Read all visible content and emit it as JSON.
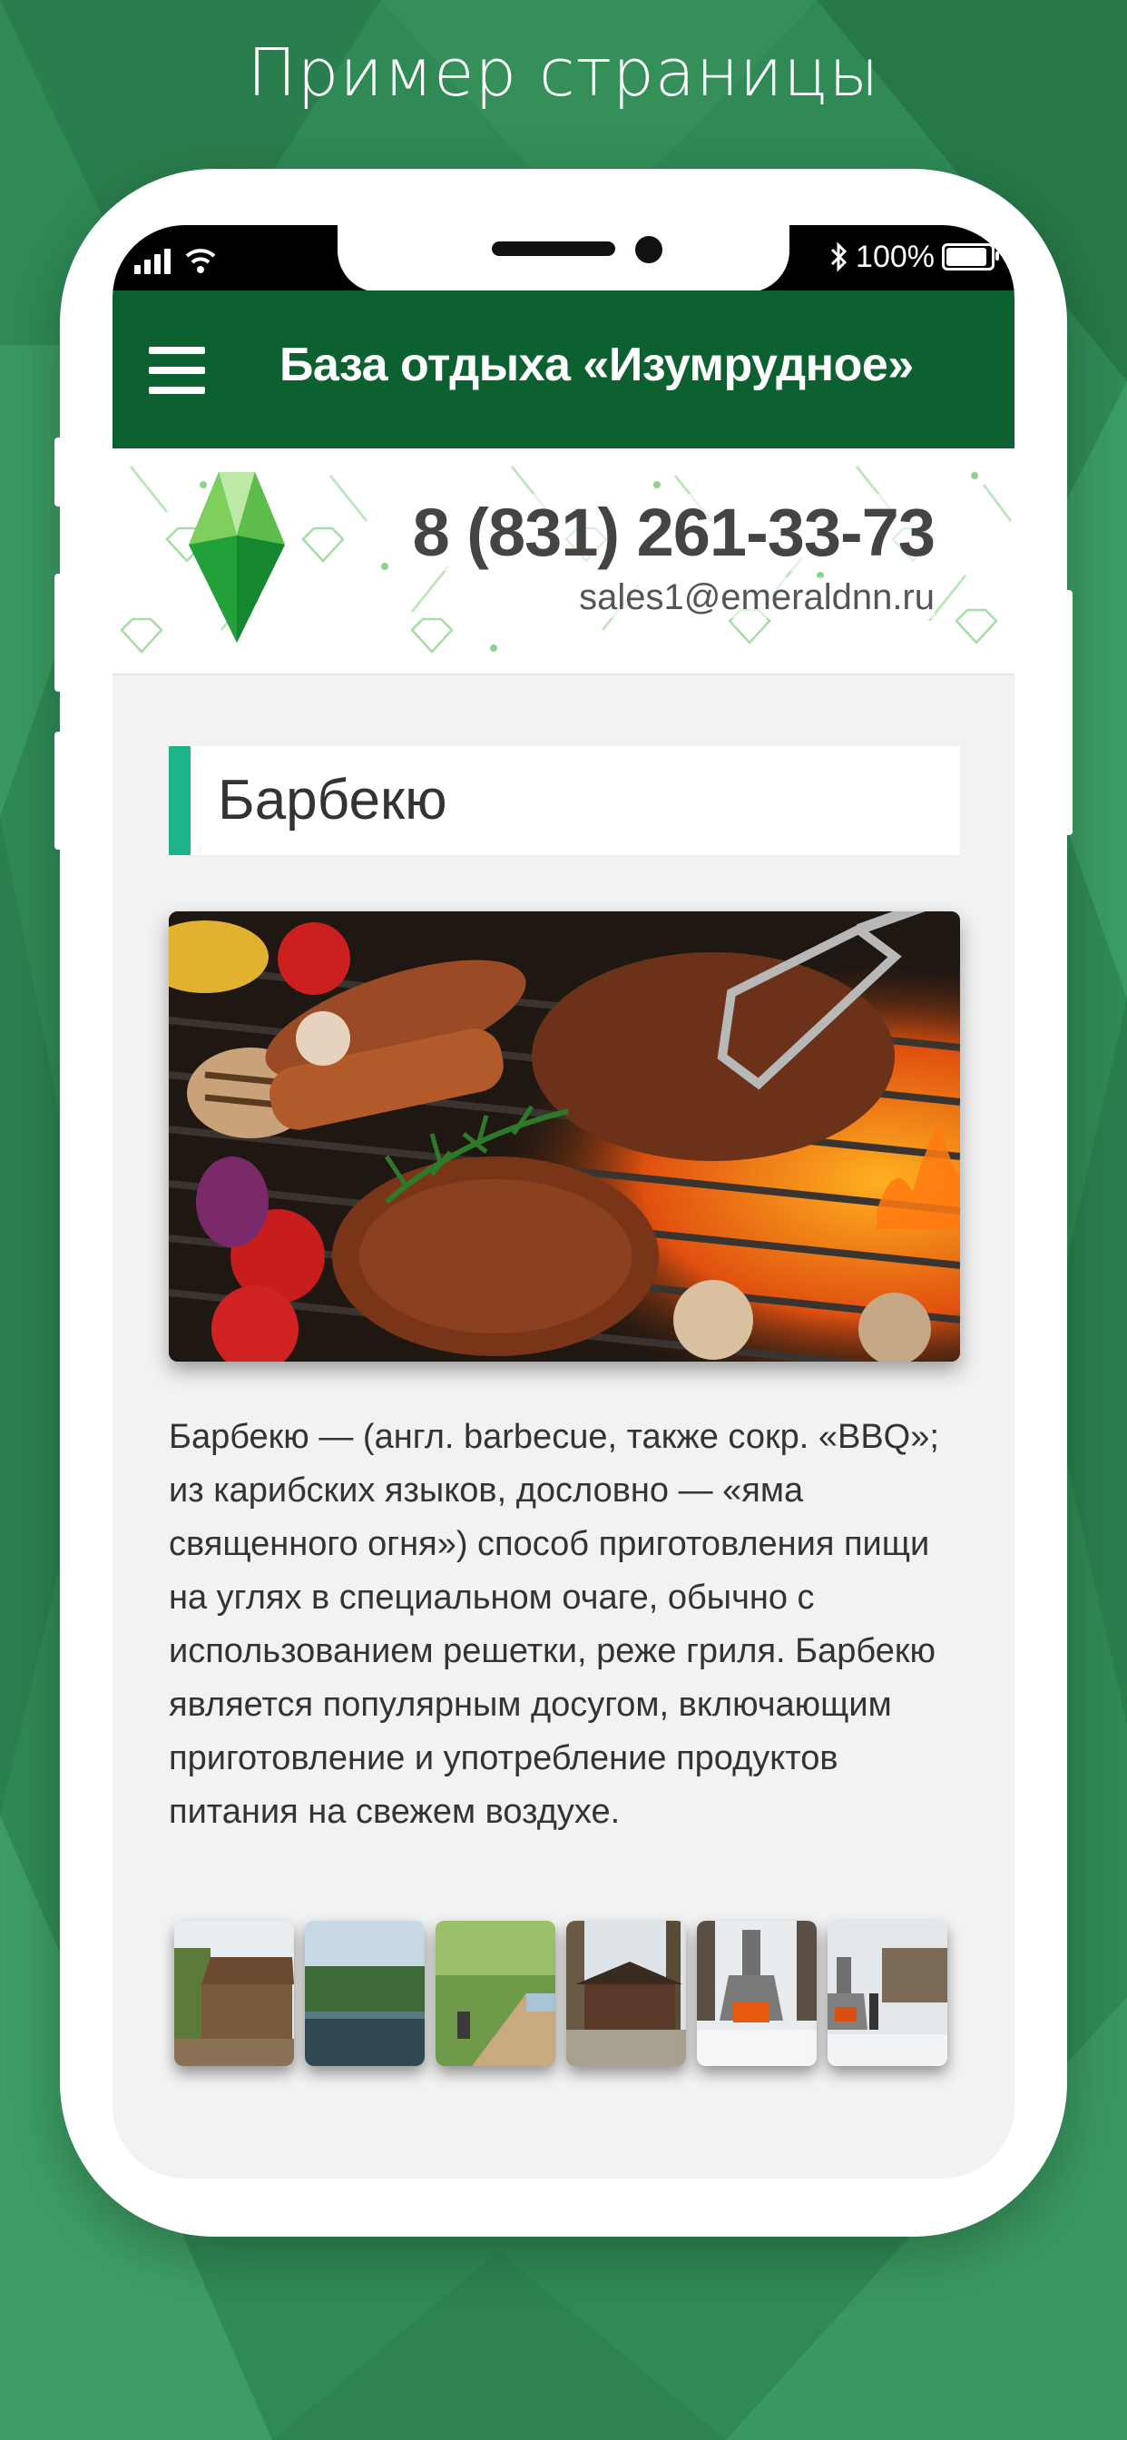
{
  "promo": {
    "title": "Пример страницы"
  },
  "status_bar": {
    "battery_percent": "100%",
    "battery_level": 1.0,
    "icons": [
      "signal-icon",
      "wifi-icon",
      "bluetooth-icon",
      "battery-icon"
    ]
  },
  "header": {
    "title": "База отдыха «Изумрудное»",
    "menu_icon": "hamburger-menu-icon"
  },
  "contact": {
    "phone": "8 (831) 261-33-73",
    "email": "sales1@emeraldnn.ru",
    "logo": "emerald-crystal-logo"
  },
  "article": {
    "title": "Барбекю",
    "hero_image": "grilled-meat-vegetables-photo",
    "body": "Барбекю — (англ. barbecue, также сокр. «BBQ»; из карибских языков, дословно — «яма священного огня») способ приготовления пищи на углях в специальном очаге, обычно с использованием решетки, реже гриля. Барбекю является популярным досугом, включающим приготовление и употребление продуктов питания на свежем воздухе."
  },
  "gallery": {
    "items": [
      {
        "name": "gazebo-forest-photo"
      },
      {
        "name": "lake-forest-photo"
      },
      {
        "name": "lakeside-boardwalk-photo"
      },
      {
        "name": "wooden-cabin-photo"
      },
      {
        "name": "winter-bbq-grill-photo"
      },
      {
        "name": "winter-bbq-area-photo"
      }
    ]
  },
  "colors": {
    "header_green": "#0d6131",
    "accent_teal": "#1fb38a",
    "background_green": "#2f8a55"
  }
}
